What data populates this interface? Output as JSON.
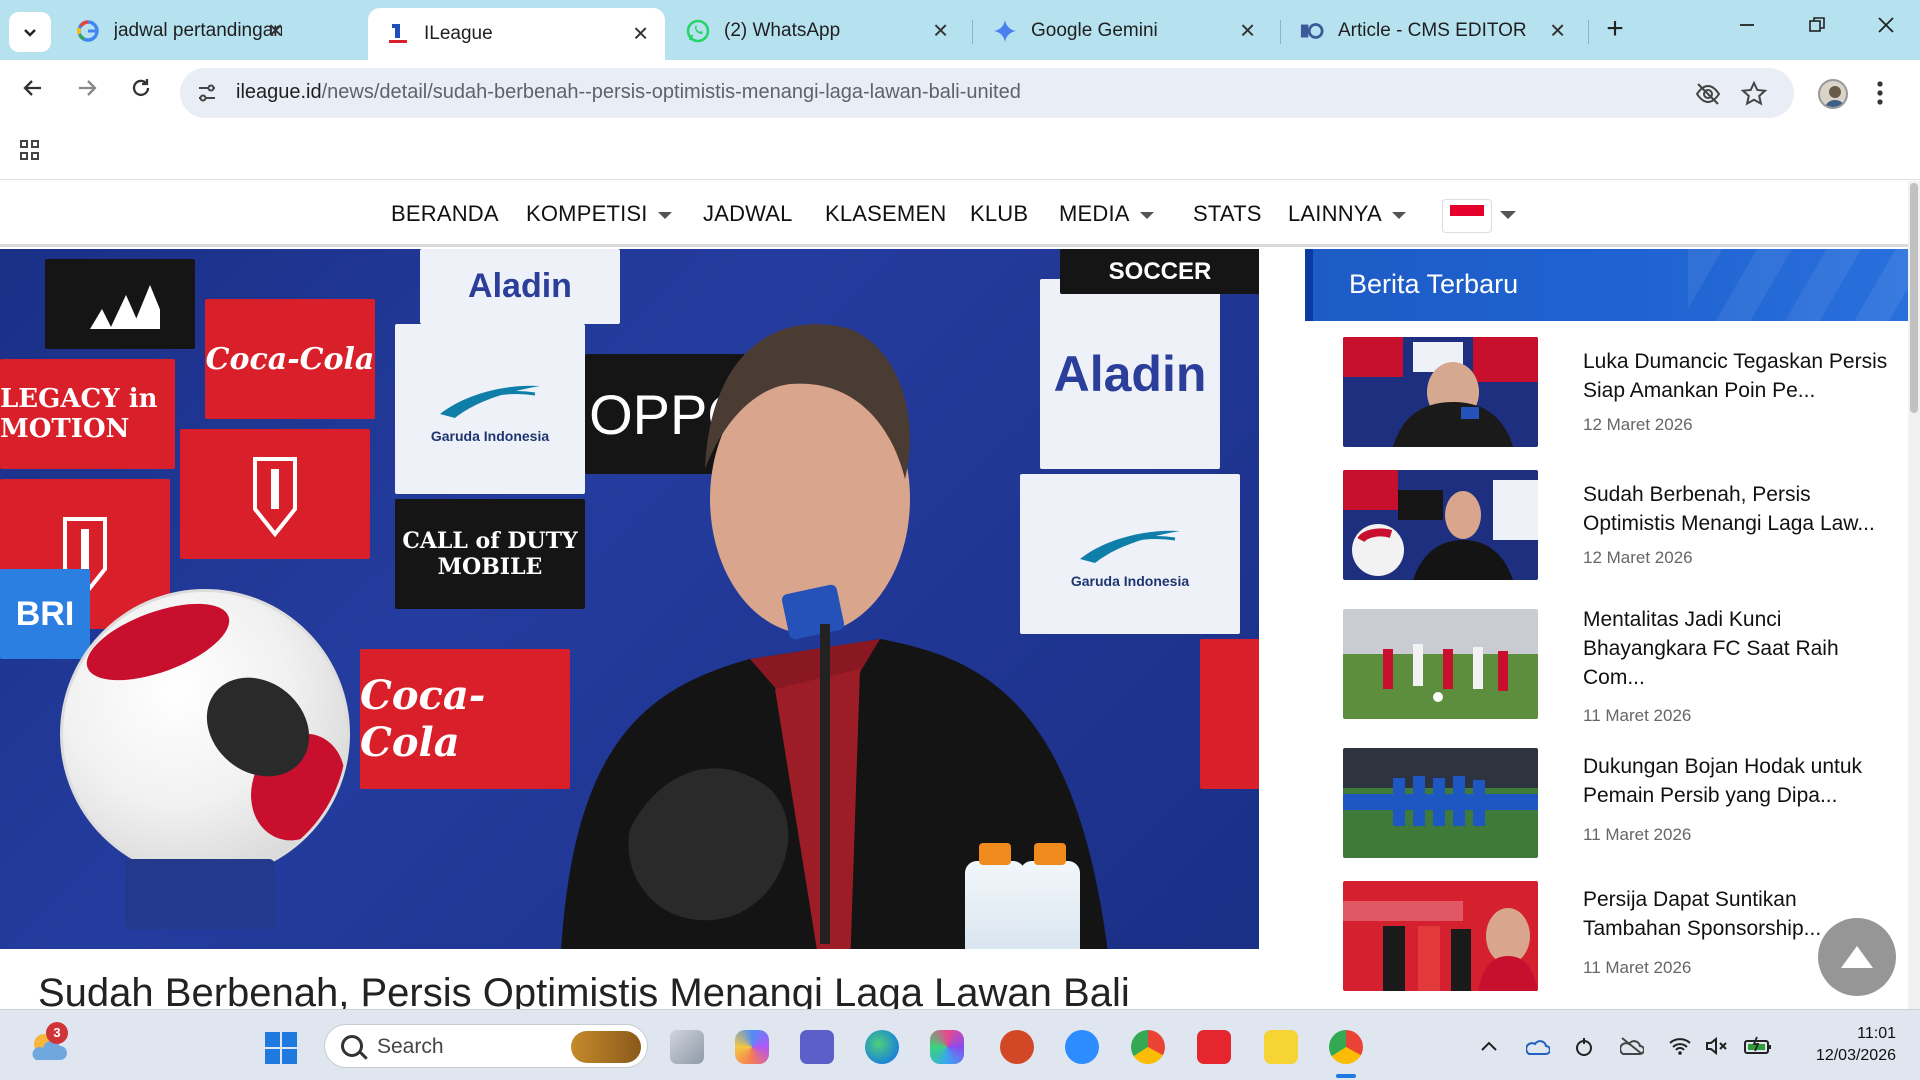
{
  "browser": {
    "tabs": [
      {
        "title": "jadwal pertandingan super",
        "favicon": "google-g-icon",
        "active": false
      },
      {
        "title": "ILeague",
        "favicon": "ileague-logo-icon",
        "active": true
      },
      {
        "title": "(2) WhatsApp",
        "favicon": "whatsapp-icon",
        "active": false
      },
      {
        "title": "Google Gemini",
        "favicon": "gemini-spark-icon",
        "active": false
      },
      {
        "title": "Article - CMS EDITOR",
        "favicon": "cms-editor-icon",
        "active": false
      }
    ],
    "url_host": "ileague.id",
    "url_path": "/news/detail/sudah-berbenah--persis-optimistis-menangi-laga-lawan-bali-united",
    "new_tab_symbol": "+",
    "close_symbol": "✕"
  },
  "site_nav": {
    "items": [
      {
        "label": "BERANDA",
        "dropdown": false
      },
      {
        "label": "KOMPETISI",
        "dropdown": true
      },
      {
        "label": "JADWAL",
        "dropdown": false
      },
      {
        "label": "KLASEMEN",
        "dropdown": false
      },
      {
        "label": "KLUB",
        "dropdown": false
      },
      {
        "label": "MEDIA",
        "dropdown": true
      },
      {
        "label": "STATS",
        "dropdown": false
      },
      {
        "label": "LAINNYA",
        "dropdown": true
      }
    ],
    "language_flag": "indonesia-flag"
  },
  "hero": {
    "sponsor_tiles": [
      "Coca-Cola",
      "Aladin",
      "OPPO",
      "CALL of DUTY MOBILE",
      "Garuda Indonesia",
      "LEGACY in MOTION",
      "SOCCER",
      "BRI"
    ]
  },
  "article": {
    "title": "Sudah Berbenah, Persis Optimistis Menangi Laga Lawan Bali"
  },
  "sidebar": {
    "heading": "Berita Terbaru",
    "news": [
      {
        "title": "Luka Dumancic Tegaskan Persis Siap Amankan Poin Pe...",
        "date": "12 Maret 2026"
      },
      {
        "title": "Sudah Berbenah, Persis Optimistis Menangi Laga Law...",
        "date": "12 Maret 2026"
      },
      {
        "title": "Mentalitas Jadi Kunci Bhayangkara FC Saat Raih Com...",
        "date": "11 Maret 2026"
      },
      {
        "title": "Dukungan Bojan Hodak untuk Pemain Persib yang Dipa...",
        "date": "11 Maret 2026"
      },
      {
        "title": "Persija Dapat Suntikan Tambahan Sponsorship...",
        "date": "11 Maret 2026"
      }
    ]
  },
  "taskbar": {
    "weather_badge": "3",
    "search_label": "Search",
    "time": "11:01",
    "date": "12/03/2026",
    "apps": [
      "file-explorer-icon",
      "copilot-icon",
      "teams-icon",
      "edge-icon",
      "m365-icon",
      "powerpoint-icon",
      "zoom-icon",
      "chrome-icon",
      "wps-icon",
      "sticky-notes-icon",
      "chrome-profile-icon"
    ]
  }
}
